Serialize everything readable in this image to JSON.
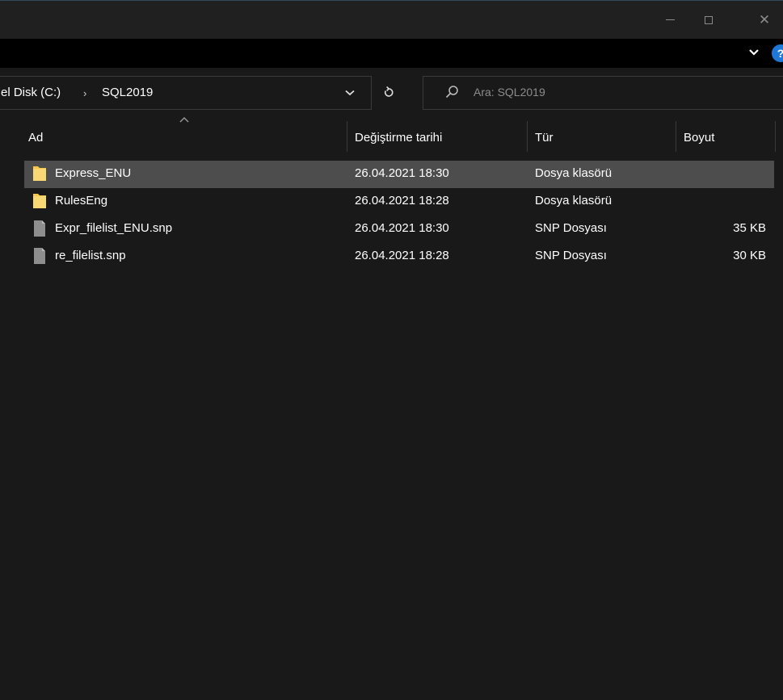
{
  "window": {
    "controls": {
      "minimize": "minimize",
      "maximize": "maximize",
      "close": "close"
    }
  },
  "address": {
    "crumbs": [
      "el Disk (C:)",
      "SQL2019"
    ],
    "separator": "›"
  },
  "search": {
    "placeholder": "Ara: SQL2019"
  },
  "columns": {
    "name": "Ad",
    "modified": "Değiştirme tarihi",
    "type": "Tür",
    "size": "Boyut"
  },
  "files": [
    {
      "name": "Express_ENU",
      "modified": "26.04.2021 18:30",
      "type": "Dosya klasörü",
      "size": "",
      "kind": "folder",
      "selected": true
    },
    {
      "name": "RulesEng",
      "modified": "26.04.2021 18:28",
      "type": "Dosya klasörü",
      "size": "",
      "kind": "folder",
      "selected": false
    },
    {
      "name": "Expr_filelist_ENU.snp",
      "modified": "26.04.2021 18:30",
      "type": "SNP Dosyası",
      "size": "35 KB",
      "kind": "file",
      "selected": false
    },
    {
      "name": "re_filelist.snp",
      "modified": "26.04.2021 18:28",
      "type": "SNP Dosyası",
      "size": "30 KB",
      "kind": "file",
      "selected": false
    }
  ],
  "icons": {
    "folder": "folder-icon",
    "file": "file-icon",
    "help": "help-icon"
  },
  "colors": {
    "background": "#191919",
    "selection": "#4d4d4d",
    "folder": "#f5c84c",
    "file": "#8e8e8e",
    "accent": "#1e78d6"
  },
  "help_label": "?"
}
